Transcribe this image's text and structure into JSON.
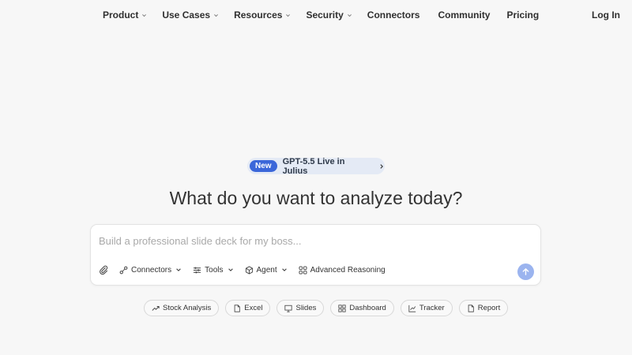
{
  "nav": {
    "items": [
      {
        "label": "Product",
        "dropdown": true
      },
      {
        "label": "Use Cases",
        "dropdown": true
      },
      {
        "label": "Resources",
        "dropdown": true
      },
      {
        "label": "Security",
        "dropdown": true
      },
      {
        "label": "Connectors",
        "dropdown": false
      },
      {
        "label": "Community",
        "dropdown": false
      },
      {
        "label": "Pricing",
        "dropdown": false
      }
    ],
    "login": "Log In"
  },
  "announcement": {
    "badge": "New",
    "text": "GPT-5.5 Live in Julius"
  },
  "headline": "What do you want to analyze today?",
  "composer": {
    "placeholder": "Build a professional slide deck for my boss...",
    "value": "",
    "toolbar": {
      "connectors": "Connectors",
      "tools": "Tools",
      "agent": "Agent",
      "advanced_reasoning": "Advanced Reasoning"
    }
  },
  "chips": [
    {
      "label": "Stock Analysis",
      "icon": "trend-icon"
    },
    {
      "label": "Excel",
      "icon": "document-icon"
    },
    {
      "label": "Slides",
      "icon": "presentation-icon"
    },
    {
      "label": "Dashboard",
      "icon": "grid-icon"
    },
    {
      "label": "Tracker",
      "icon": "line-chart-icon"
    },
    {
      "label": "Report",
      "icon": "document-icon"
    }
  ],
  "colors": {
    "background": "#f7f7f7",
    "accent": "#3b67d9",
    "pill_bg": "#e4eaf5",
    "send_button": "#9bb4ef"
  }
}
